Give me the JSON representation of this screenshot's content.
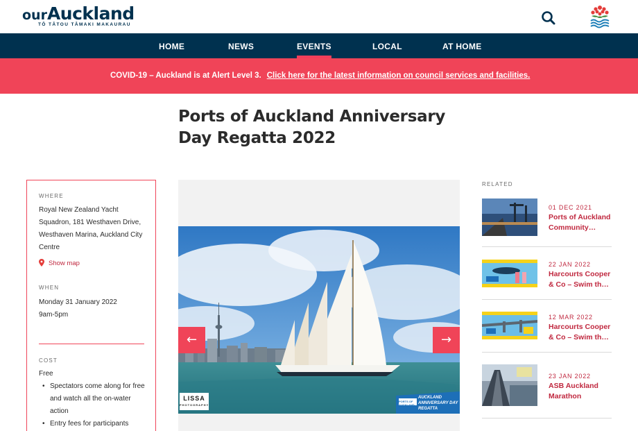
{
  "header": {
    "logo_prefix": "our",
    "logo_name": "Auckland",
    "logo_tagline": "TŌ TĀTOU TĀMAKI MAKAURAU"
  },
  "nav": {
    "items": [
      {
        "label": "HOME"
      },
      {
        "label": "NEWS"
      },
      {
        "label": "EVENTS"
      },
      {
        "label": "LOCAL"
      },
      {
        "label": "AT HOME"
      }
    ],
    "active": "EVENTS"
  },
  "alert": {
    "text": "COVID-19 – Auckland is at Alert Level 3.",
    "link": "Click here for the latest information on council services and facilities."
  },
  "event": {
    "title": "Ports of Auckland Anniversary Day Regatta 2022",
    "where_label": "WHERE",
    "where": "Royal New Zealand Yacht Squadron, 181 Westhaven Drive, Westhaven Marina, Auckland City Centre",
    "map_link": "Show map",
    "when_label": "WHEN",
    "date": "Monday 31 January 2022",
    "time": "9am-5pm",
    "cost_label": "COST",
    "cost": "Free",
    "cost_notes": [
      "Spectators come along for free and watch all the on-water action",
      "Entry fees for participants"
    ]
  },
  "carousel": {
    "watermark": "LISSA",
    "watermark_sub": "PHOTOGRAPHY",
    "badge_brand": "PORTS OF AUCKLAND",
    "badge_text": "AUCKLAND ANNIVERSARY DAY REGATTA",
    "prev_icon": "arrow-left-icon",
    "next_icon": "arrow-right-icon"
  },
  "related": {
    "label": "RELATED",
    "items": [
      {
        "date": "01 DEC 2021",
        "title": "Ports of Auckland Community…"
      },
      {
        "date": "22 JAN 2022",
        "title": "Harcourts Cooper & Co – Swim th…"
      },
      {
        "date": "12 MAR 2022",
        "title": "Harcourts Cooper & Co – Swim th…"
      },
      {
        "date": "23 JAN 2022",
        "title": "ASB Auckland Marathon"
      }
    ]
  },
  "colors": {
    "navy": "#00314f",
    "accent": "#f04458",
    "link_red": "#c0283f"
  }
}
